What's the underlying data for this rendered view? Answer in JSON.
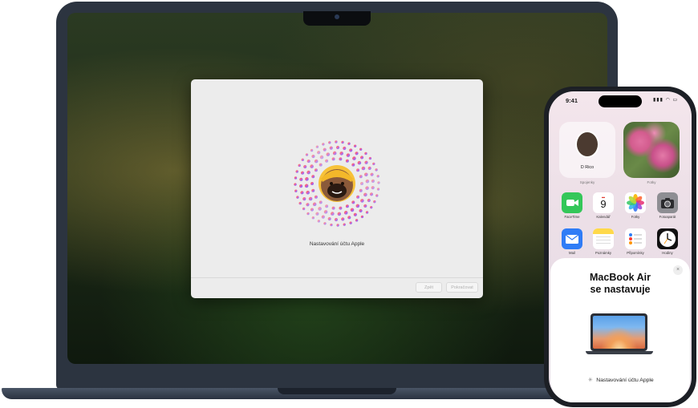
{
  "mac": {
    "setup_title": "Nastavování účtu Apple",
    "back_label": "Zpět",
    "continue_label": "Pokračovat"
  },
  "phone": {
    "status_time": "9:41",
    "status_icons": "▮▮▮ ◠ ▭",
    "contact_name": "D Rico",
    "contact_caption": "Spojenky",
    "photo_caption": "Fotky",
    "calendar_day": "9",
    "apps": [
      {
        "label": "FaceTime",
        "icon": "facetime-icon",
        "color": "#34c759"
      },
      {
        "label": "Kalendář",
        "icon": "calendar-icon",
        "color": "#ffffff"
      },
      {
        "label": "Fotky",
        "icon": "photos-icon",
        "color": "#ffffff"
      },
      {
        "label": "Fotoaparát",
        "icon": "camera-icon",
        "color": "#8e8e93"
      },
      {
        "label": "Mail",
        "icon": "mail-icon",
        "color": "#2f7cf6"
      },
      {
        "label": "Poznámky",
        "icon": "notes-icon",
        "color": "#ffd94a"
      },
      {
        "label": "Připomínky",
        "icon": "reminders-icon",
        "color": "#ffffff"
      },
      {
        "label": "Hodiny",
        "icon": "clock-icon",
        "color": "#111111"
      }
    ],
    "sheet": {
      "title_line1": "MacBook Air",
      "title_line2": "se nastavuje",
      "close_glyph": "×",
      "status": "Nastavování účtu Apple",
      "spinner_glyph": "✳"
    }
  }
}
